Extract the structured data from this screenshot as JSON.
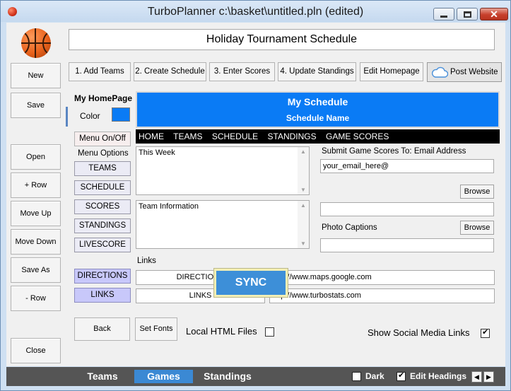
{
  "window": {
    "title": "TurboPlanner c:\\basket\\untitled.pln (edited)"
  },
  "header": {
    "schedule_title": "Holiday Tournament Schedule"
  },
  "left_buttons": [
    "New",
    "Save",
    "Open",
    "+ Row",
    "Move Up",
    "Move Down",
    "Save As",
    "- Row",
    "Close"
  ],
  "toolbar": {
    "add_teams": "1. Add Teams",
    "create_schedule": "2. Create Schedule",
    "enter_scores": "3. Enter Scores",
    "update_standings": "4. Update Standings",
    "edit_homepage": "Edit Homepage",
    "post_website": "Post Website"
  },
  "homepage": {
    "label": "My HomePage",
    "color_label": "Color",
    "color_value": "#0a7bf5",
    "menu_toggle": "Menu On/Off",
    "menu_options_label": "Menu Options",
    "menu_options": [
      "TEAMS",
      "SCHEDULE",
      "SCORES",
      "STANDINGS",
      "LIVESCORE"
    ],
    "link_options": [
      "DIRECTIONS",
      "LINKS"
    ]
  },
  "preview": {
    "title": "My Schedule",
    "subtitle": "Schedule Name",
    "nav": [
      "HOME",
      "TEAMS",
      "SCHEDULE",
      "STANDINGS",
      "GAME SCORES"
    ]
  },
  "content": {
    "this_week": "This Week",
    "team_info": "Team Information",
    "submit_label": "Submit Game Scores To: Email Address",
    "email_value": "your_email_here@",
    "browse1": "Browse",
    "image_path": "",
    "photo_captions_label": "Photo Captions",
    "browse2": "Browse",
    "photo_caption_value": ""
  },
  "links": {
    "label": "Links",
    "rows": [
      {
        "name": "DIRECTIONS",
        "url": "http://www.maps.google.com"
      },
      {
        "name": "LINKS",
        "url": "http://www.turbostats.com"
      }
    ]
  },
  "actions": {
    "back": "Back",
    "set_fonts": "Set Fonts",
    "local_html": "Local HTML Files",
    "sync": "SYNC",
    "social": "Show Social Media Links"
  },
  "bottom": {
    "tabs": [
      "Teams",
      "Games",
      "Standings"
    ],
    "active_tab": "Games",
    "dark_label": "Dark",
    "edit_headings_label": "Edit Headings"
  }
}
